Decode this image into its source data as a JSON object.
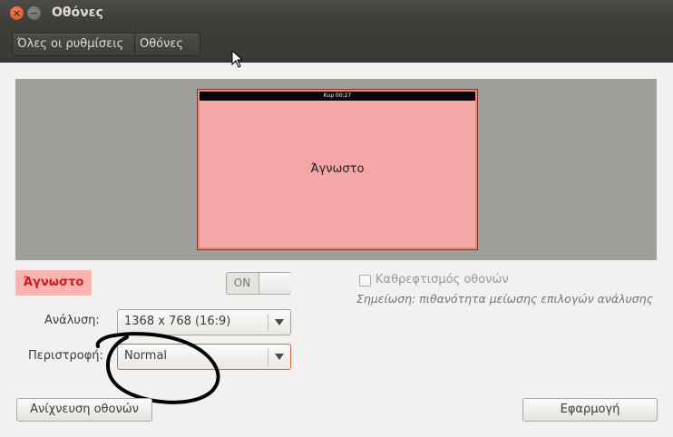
{
  "window": {
    "title": "Οθόνες",
    "close_glyph": "×",
    "minimize_glyph": "−"
  },
  "toolbar": {
    "breadcrumb": [
      "Όλες οι ρυθμίσεις",
      "Οθόνες"
    ]
  },
  "monitor_preview": {
    "panel_clock": "Κυρ 00:27",
    "label": "Άγνωστο",
    "color": "#f5a6a6"
  },
  "display": {
    "name": "Άγνωστο",
    "switch_label": "ON",
    "mirror_label": "Καθρεφτισμός οθονών",
    "mirror_checked": false,
    "mirror_note": "Σημείωση: πιθανότητα μείωσης επιλογών ανάλυσης"
  },
  "form": {
    "resolution_label": "Ανάλυση:",
    "resolution_value": "1368 x 768 (16:9)",
    "rotation_label": "Περιστροφή:",
    "rotation_value": "Normal"
  },
  "buttons": {
    "detect": "Ανίχνευση οθονών",
    "apply": "Εφαρμογή"
  },
  "colors": {
    "accent": "#e0673a",
    "display_tag_bg": "#ffb3b3",
    "display_tag_text": "#d01818"
  }
}
